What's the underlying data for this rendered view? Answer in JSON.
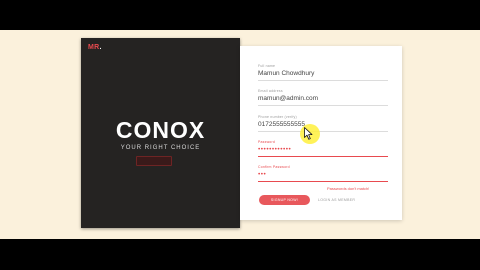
{
  "logo": {
    "text": "MR",
    "dot": "."
  },
  "brand": {
    "name": "CONOX",
    "tagline": "YOUR RIGHT CHOICE"
  },
  "form": {
    "fields": [
      {
        "label": "Full name",
        "value": "Mamun Chowdhury"
      },
      {
        "label": "Email address",
        "value": "mamun@admin.com"
      },
      {
        "label": "Phone number (verify)",
        "value": "0172555555555"
      },
      {
        "label": "Password",
        "value": "••••••••••••"
      },
      {
        "label": "Confirm Password",
        "value": "•••"
      }
    ],
    "error": "Passwords don't match!",
    "primary_button": "SIGNUP NOW!",
    "secondary_link": "LOGIN AS MEMBER"
  },
  "colors": {
    "accent": "#e84a4f",
    "dark_panel": "#252322",
    "background": "#fbf1dc"
  }
}
